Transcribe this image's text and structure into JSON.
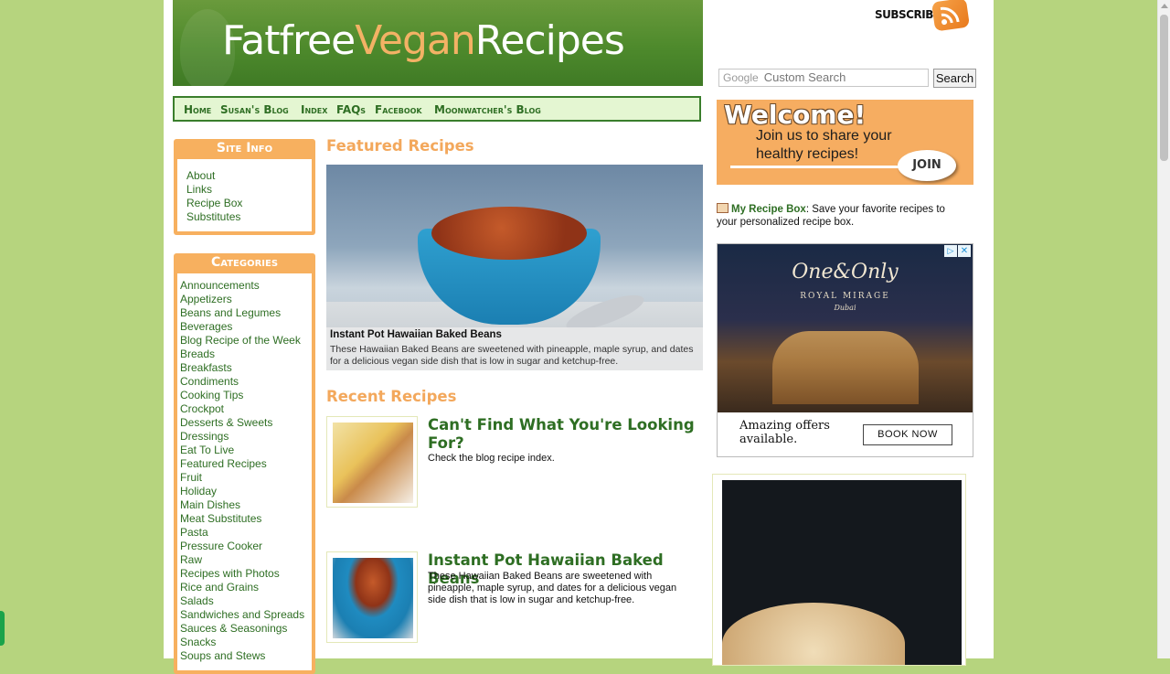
{
  "header": {
    "title_part1": "Fatfree",
    "title_part2": "Vegan",
    "title_part3": "Recipes",
    "subscribe_label": "SUBSCRIBE"
  },
  "search": {
    "provider_label": "Google",
    "placeholder": "Custom Search",
    "button_label": "Search"
  },
  "nav": {
    "items": [
      "Home",
      "Susan's Blog",
      "Index",
      "FAQs",
      "Facebook",
      "Moonwatcher's Blog"
    ]
  },
  "site_info": {
    "title": "Site Info",
    "links": [
      "About",
      "Links",
      "Recipe Box",
      "Substitutes"
    ]
  },
  "categories": {
    "title": "Categories",
    "links": [
      "Announcements",
      "Appetizers",
      "Beans and Legumes",
      "Beverages",
      "Blog Recipe of the Week",
      "Breads",
      "Breakfasts",
      "Condiments",
      "Cooking Tips",
      "Crockpot",
      "Desserts & Sweets",
      "Dressings",
      "Eat To Live",
      "Featured Recipes",
      "Fruit",
      "Holiday",
      "Main Dishes",
      "Meat Substitutes",
      "Pasta",
      "Pressure Cooker",
      "Raw",
      "Recipes with Photos",
      "Rice and Grains",
      "Salads",
      "Sandwiches and Spreads",
      "Sauces & Seasonings",
      "Snacks",
      "Soups and Stews"
    ]
  },
  "featured": {
    "section_title": "Featured Recipes",
    "caption_title": "Instant Pot Hawaiian Baked Beans",
    "caption_text": "These Hawaiian Baked Beans are sweetened with pineapple, maple syrup, and dates for a delicious vegan side dish that is low in sugar and ketchup-free."
  },
  "recent": {
    "section_title": "Recent Recipes",
    "posts": [
      {
        "title": "Can't Find What You're Looking For?",
        "text": "Check the blog recipe index."
      },
      {
        "title": "Instant Pot Hawaiian Baked Beans",
        "text": "These Hawaiian Baked Beans are sweetened with pineapple, maple syrup, and dates for a delicious vegan side dish that is low in sugar and ketchup-free."
      }
    ]
  },
  "welcome": {
    "heading": "Welcome!",
    "text_line1": "Join us to share your",
    "text_line2": "healthy recipes!",
    "button_label": "JOIN"
  },
  "recipe_box": {
    "link_label": "My Recipe Box",
    "text": ": Save your favorite recipes to your personalized recipe box."
  },
  "ad": {
    "brand": "One&Only",
    "subtitle": "ROYAL MIRAGE",
    "location": "Dubai",
    "offer_line1": "Amazing offers",
    "offer_line2": "available.",
    "button_label": "BOOK NOW",
    "choices_glyph": "▷",
    "close_glyph": "✕"
  }
}
